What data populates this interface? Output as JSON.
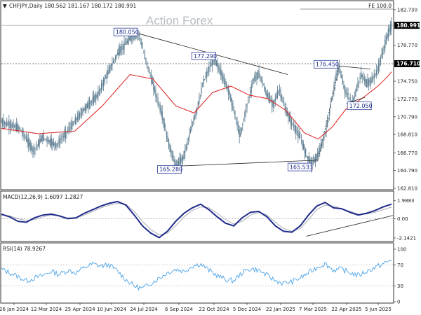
{
  "header": {
    "symbol_line": "CHFJPY,Daily  180.562 181.167 180.172 180.991",
    "watermark": "Action Forex",
    "fe_label": "FE 100.0"
  },
  "colors": {
    "candle": "#5b7c90",
    "ma": "#e01b1b",
    "macd": "#1f2a8c",
    "signal": "#a8aeb6",
    "rsi": "#4aa3e8",
    "trendline": "#222222",
    "annotation_border": "#2a3d9a",
    "price_tag": "#000000"
  },
  "chart_data": [
    {
      "type": "candlestick",
      "ylim": [
        162.81,
        183.5
      ],
      "yticks": [
        "182.730",
        "180.991",
        "178.770",
        "176.710",
        "174.750",
        "172.770",
        "170.790",
        "168.810",
        "166.770",
        "164.790",
        "162.810"
      ],
      "ytick_values": [
        182.73,
        180.991,
        178.77,
        176.71,
        174.75,
        172.77,
        170.79,
        168.81,
        166.77,
        164.79,
        162.81
      ],
      "last_price": "180.991",
      "horizontal_level": {
        "value": 176.71,
        "label": "176.710"
      },
      "xticks": [
        "26 Jan 2024",
        "12 Mar 2024",
        "25 Apr 2024",
        "10 Jun 2024",
        "24 Jul 2024",
        "6 Sep 2024",
        "22 Oct 2024",
        "5 Dec 2024",
        "22 Jan 2025",
        "7 Mar 2025",
        "22 Apr 2025",
        "5 Jun 2025"
      ],
      "path_points": [
        [
          0,
          170.2
        ],
        [
          20,
          169.5
        ],
        [
          35,
          167.0
        ],
        [
          45,
          168.5
        ],
        [
          60,
          167.6
        ],
        [
          75,
          169.6
        ],
        [
          90,
          171.6
        ],
        [
          105,
          173.2
        ],
        [
          117,
          175.9
        ],
        [
          127,
          177.9
        ],
        [
          140,
          179.5
        ],
        [
          150,
          180.05
        ],
        [
          155,
          178.0
        ],
        [
          160,
          176.2
        ],
        [
          167,
          173.8
        ],
        [
          175,
          171.0
        ],
        [
          183,
          167.5
        ],
        [
          190,
          165.28
        ],
        [
          198,
          166.2
        ],
        [
          205,
          168.8
        ],
        [
          212,
          171.2
        ],
        [
          220,
          174.6
        ],
        [
          227,
          176.3
        ],
        [
          232,
          177.29
        ],
        [
          240,
          175.5
        ],
        [
          248,
          173.6
        ],
        [
          255,
          170.8
        ],
        [
          260,
          168.6
        ],
        [
          267,
          171.8
        ],
        [
          275,
          175.0
        ],
        [
          281,
          175.6
        ],
        [
          288,
          173.5
        ],
        [
          296,
          172.2
        ],
        [
          303,
          173.8
        ],
        [
          310,
          171.4
        ],
        [
          318,
          169.8
        ],
        [
          326,
          168.4
        ],
        [
          332,
          166.6
        ],
        [
          337,
          165.5
        ],
        [
          343,
          166.2
        ],
        [
          350,
          167.8
        ],
        [
          356,
          170.4
        ],
        [
          360,
          172.8
        ],
        [
          364,
          175.0
        ],
        [
          368,
          176.45
        ],
        [
          373,
          174.1
        ],
        [
          378,
          173.0
        ],
        [
          383,
          172.2
        ],
        [
          387,
          173.9
        ],
        [
          392,
          175.5
        ],
        [
          398,
          174.5
        ],
        [
          403,
          174.8
        ],
        [
          410,
          176.0
        ],
        [
          416,
          178.2
        ],
        [
          421,
          180.0
        ],
        [
          425,
          180.991
        ]
      ],
      "ma_points": [
        [
          0,
          169.5
        ],
        [
          40,
          168.9
        ],
        [
          80,
          169.2
        ],
        [
          110,
          172.0
        ],
        [
          140,
          175.5
        ],
        [
          165,
          175.0
        ],
        [
          190,
          172.0
        ],
        [
          210,
          171.2
        ],
        [
          230,
          173.5
        ],
        [
          250,
          174.2
        ],
        [
          270,
          173.2
        ],
        [
          290,
          172.8
        ],
        [
          310,
          171.5
        ],
        [
          330,
          169.0
        ],
        [
          345,
          168.3
        ],
        [
          360,
          169.6
        ],
        [
          375,
          171.6
        ],
        [
          395,
          173.0
        ],
        [
          410,
          174.2
        ],
        [
          420,
          175.2
        ],
        [
          425,
          175.8
        ]
      ],
      "annotations": [
        {
          "label": "180.050",
          "x": 150,
          "y": 180.05
        },
        {
          "label": "177.290",
          "x": 232,
          "y": 177.29
        },
        {
          "label": "176.450",
          "x": 368,
          "y": 176.45
        },
        {
          "label": "165.280",
          "x": 190,
          "y": 165.28
        },
        {
          "label": "165.533",
          "x": 332,
          "y": 165.533
        },
        {
          "label": "172.050",
          "x": 380,
          "y": 172.05
        }
      ],
      "trendlines": [
        {
          "from": [
            150,
            180.05
          ],
          "to": [
            312,
            175.5
          ]
        },
        {
          "from": [
            190,
            165.28
          ],
          "to": [
            345,
            165.95
          ]
        },
        {
          "from": [
            368,
            176.45
          ],
          "to": [
            402,
            176.1
          ]
        },
        {
          "from": [
            376,
            172.3
          ],
          "to": [
            396,
            172.95
          ]
        }
      ]
    },
    {
      "type": "line",
      "title": "MACD(12,26,9) 1.6097 1.2827",
      "ylim": [
        -2.3,
        2.2
      ],
      "yticks": [
        "1.9883",
        "0.00",
        "-2.1421"
      ],
      "ytick_values": [
        1.9883,
        0,
        -2.1421
      ],
      "series": [
        {
          "values": [
            0.5,
            0.2,
            -0.3,
            -0.4,
            0.1,
            0.4,
            0.5,
            0.3,
            0.0,
            0.1,
            0.6,
            1.0,
            1.4,
            1.7,
            1.9,
            1.5,
            0.4,
            -0.8,
            -1.6,
            -2.1,
            -1.4,
            -0.3,
            0.6,
            1.2,
            1.6,
            1.0,
            0.2,
            -0.5,
            -0.8,
            0.1,
            0.7,
            0.8,
            0.2,
            -0.8,
            -1.4,
            -1.5,
            -0.8,
            0.4,
            1.4,
            1.8,
            1.2,
            1.1,
            0.7,
            0.4,
            0.6,
            0.9,
            1.3,
            1.6
          ]
        },
        {
          "values": [
            0.4,
            0.3,
            0.0,
            -0.2,
            -0.1,
            0.2,
            0.4,
            0.3,
            0.1,
            0.1,
            0.4,
            0.8,
            1.2,
            1.5,
            1.7,
            1.6,
            0.8,
            -0.3,
            -1.2,
            -1.8,
            -1.6,
            -0.8,
            0.2,
            0.9,
            1.3,
            1.2,
            0.6,
            -0.1,
            -0.6,
            -0.3,
            0.4,
            0.7,
            0.4,
            -0.4,
            -1.1,
            -1.4,
            -1.1,
            -0.1,
            1.0,
            1.5,
            1.4,
            1.1,
            0.8,
            0.5,
            0.5,
            0.7,
            1.0,
            1.28
          ]
        }
      ],
      "trendline": {
        "from": [
          -1.95
        ],
        "to": [
          0.35
        ]
      }
    },
    {
      "type": "line",
      "title": "RSI(14) 78.9267",
      "ylim": [
        0,
        100
      ],
      "yticks": [
        "100",
        "70",
        "30",
        "0"
      ],
      "ytick_values": [
        100,
        70,
        30,
        0
      ],
      "series": [
        {
          "values": [
            62,
            55,
            48,
            40,
            45,
            50,
            58,
            52,
            60,
            55,
            65,
            72,
            68,
            70,
            58,
            42,
            30,
            25,
            35,
            45,
            55,
            62,
            58,
            68,
            72,
            60,
            50,
            42,
            40,
            55,
            63,
            60,
            50,
            40,
            35,
            38,
            45,
            55,
            65,
            73,
            60,
            62,
            55,
            50,
            58,
            65,
            72,
            78.9
          ]
        }
      ]
    }
  ]
}
